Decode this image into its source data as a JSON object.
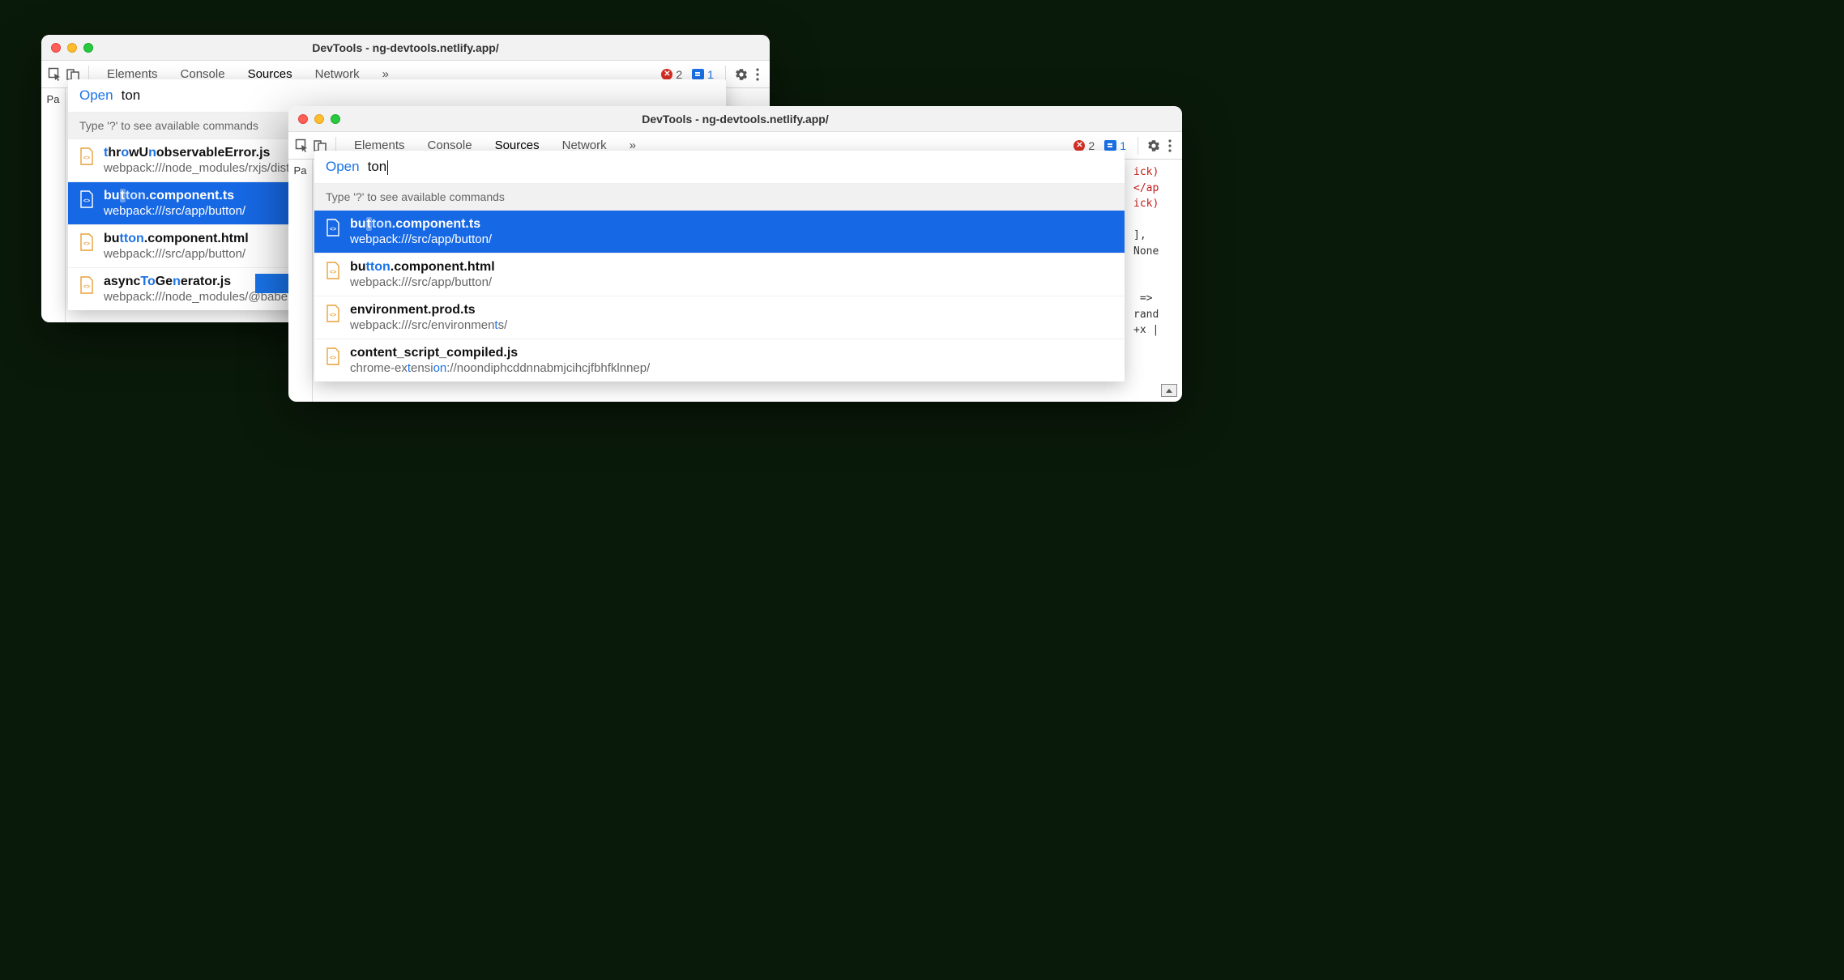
{
  "windows": {
    "left": {
      "title": "DevTools - ng-devtools.netlify.app/"
    },
    "right": {
      "title": "DevTools - ng-devtools.netlify.app/"
    }
  },
  "toolbar": {
    "tabs": {
      "elements": "Elements",
      "console": "Console",
      "sources": "Sources",
      "network": "Network"
    },
    "errors_count": "2",
    "messages_count": "1"
  },
  "panel": {
    "left_tab": "Pa",
    "tree_marker": "◥ </"
  },
  "search": {
    "open_label": "Open",
    "query": "ton",
    "hint": "Type '?' to see available commands"
  },
  "results_left": [
    {
      "name_html": "<span class='hl'>t</span>hr<span class='hl'>o</span>wU<span class='hl'>n</span>observableError.js",
      "path": "webpack:///node_modules/rxjs/dist/esm",
      "kind": "js",
      "selected": false
    },
    {
      "name_html": "bu<span class='hl-box'>t</span><span class='hl'>ton</span>.component.ts",
      "path": "webpack:///src/app/button/",
      "kind": "ts",
      "selected": true
    },
    {
      "name_html": "bu<span class='hl'>t</span><span class='hl'>ton</span>.component.html",
      "path": "webpack:///src/app/button/",
      "kind": "html",
      "selected": false
    },
    {
      "name_html": "async<span class='hl'>To</span>Ge<span class='hl'>n</span>erator.js",
      "path": "webpack:///node_modules/@babel/",
      "kind": "js",
      "selected": false
    }
  ],
  "results_right": [
    {
      "name_html": "bu<span class='hl-box'>t</span><span class='hl'>ton</span>.component.ts",
      "path": "webpack:///src/app/button/",
      "kind": "ts",
      "selected": true
    },
    {
      "name_html": "bu<span class='hl'>t</span><span class='hl'>ton</span>.component.html",
      "path": "webpack:///src/app/button/",
      "kind": "html",
      "selected": false
    },
    {
      "name_html": "environment.prod.ts",
      "path_html": "webpack:///src/environmen<span class='hl'>t</span>s/",
      "kind": "ts",
      "selected": false
    },
    {
      "name_html": "content_script_compiled.js",
      "path_html": "chrome-ex<span class='hl'>t</span>ensi<span class='hl'>on</span>://noondiphcddnnabmjcihcjfbhfklnnep/",
      "kind": "js",
      "selected": false
    }
  ],
  "code_peek": {
    "lines": [
      "ick)",
      "</ap",
      "ick)",
      "",
      "],",
      "None",
      "",
      "",
      " =>",
      "rand",
      "+x |"
    ]
  }
}
